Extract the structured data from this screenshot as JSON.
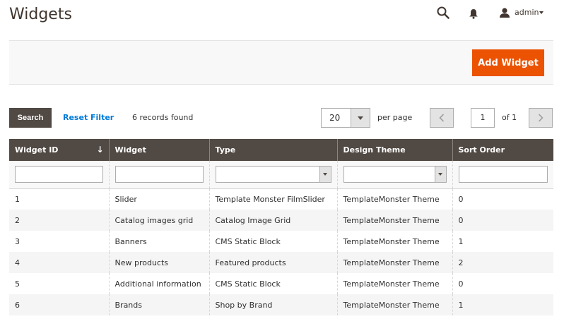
{
  "header": {
    "title": "Widgets",
    "user_label": "admin",
    "icons": [
      "search-icon",
      "bell-icon",
      "user-icon",
      "caret-down-icon"
    ]
  },
  "actions": {
    "add_widget_label": "Add Widget",
    "accent_color": "#eb5202"
  },
  "toolbar": {
    "search_label": "Search",
    "reset_filter_label": "Reset Filter",
    "records_found": "6 records found",
    "per_page_value": "20",
    "per_page_label": "per page",
    "current_page": "1",
    "of_pages": "of 1",
    "prev_icon": "chevron-left-icon",
    "next_icon": "chevron-right-icon"
  },
  "grid": {
    "columns": [
      {
        "label": "Widget ID"
      },
      {
        "label": "Widget"
      },
      {
        "label": "Type"
      },
      {
        "label": "Design Theme"
      },
      {
        "label": "Sort Order"
      }
    ],
    "rows": [
      {
        "id": "1",
        "widget": "Slider",
        "type": "Template Monster FilmSlider",
        "theme": "TemplateMonster Theme",
        "sort": "0"
      },
      {
        "id": "2",
        "widget": "Catalog images grid",
        "type": "Catalog Image Grid",
        "theme": "TemplateMonster Theme",
        "sort": "0"
      },
      {
        "id": "3",
        "widget": "Banners",
        "type": "CMS Static Block",
        "theme": "TemplateMonster Theme",
        "sort": "1"
      },
      {
        "id": "4",
        "widget": "New products",
        "type": "Featured products",
        "theme": "TemplateMonster Theme",
        "sort": "2"
      },
      {
        "id": "5",
        "widget": "Additional information",
        "type": "CMS Static Block",
        "theme": "TemplateMonster Theme",
        "sort": "0"
      },
      {
        "id": "6",
        "widget": "Brands",
        "type": "Shop by Brand",
        "theme": "TemplateMonster Theme",
        "sort": "1"
      }
    ]
  }
}
